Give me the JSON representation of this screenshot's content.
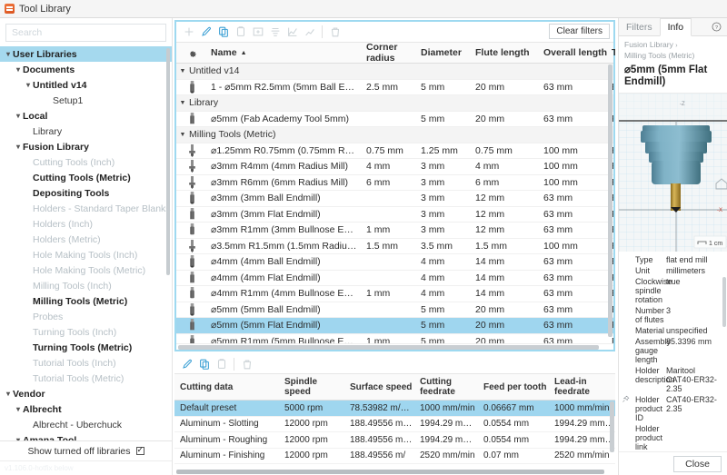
{
  "window": {
    "title": "Tool Library",
    "icon": "fusion-app-icon"
  },
  "search": {
    "placeholder": "Search",
    "value": ""
  },
  "sidebar": {
    "items": [
      {
        "label": "User Libraries",
        "indent": 0,
        "caret": "▾",
        "style": "bold",
        "selected": true
      },
      {
        "label": "Documents",
        "indent": 1,
        "caret": "▾",
        "style": "bold",
        "selected": false
      },
      {
        "label": "Untitled v14",
        "indent": 2,
        "caret": "▾",
        "style": "bold",
        "selected": false
      },
      {
        "label": "Setup1",
        "indent": 4,
        "caret": "",
        "style": "plain",
        "selected": false
      },
      {
        "label": "Local",
        "indent": 1,
        "caret": "▾",
        "style": "bold",
        "selected": false
      },
      {
        "label": "Library",
        "indent": 2,
        "caret": "",
        "style": "plain",
        "selected": false
      },
      {
        "label": "Fusion Library",
        "indent": 1,
        "caret": "▾",
        "style": "bold",
        "selected": false
      },
      {
        "label": "Cutting Tools (Inch)",
        "indent": 2,
        "caret": "",
        "style": "dim",
        "selected": false
      },
      {
        "label": "Cutting Tools (Metric)",
        "indent": 2,
        "caret": "",
        "style": "bold",
        "selected": false
      },
      {
        "label": "Depositing Tools",
        "indent": 2,
        "caret": "",
        "style": "bold",
        "selected": false
      },
      {
        "label": "Holders - Standard Taper Blanks",
        "indent": 2,
        "caret": "",
        "style": "dim",
        "selected": false
      },
      {
        "label": "Holders (Inch)",
        "indent": 2,
        "caret": "",
        "style": "dim",
        "selected": false
      },
      {
        "label": "Holders (Metric)",
        "indent": 2,
        "caret": "",
        "style": "dim",
        "selected": false
      },
      {
        "label": "Hole Making Tools (Inch)",
        "indent": 2,
        "caret": "",
        "style": "dim",
        "selected": false
      },
      {
        "label": "Hole Making Tools (Metric)",
        "indent": 2,
        "caret": "",
        "style": "dim",
        "selected": false
      },
      {
        "label": "Milling Tools (Inch)",
        "indent": 2,
        "caret": "",
        "style": "dim",
        "selected": false
      },
      {
        "label": "Milling Tools (Metric)",
        "indent": 2,
        "caret": "",
        "style": "bold",
        "selected": false
      },
      {
        "label": "Probes",
        "indent": 2,
        "caret": "",
        "style": "dim",
        "selected": false
      },
      {
        "label": "Turning Tools (Inch)",
        "indent": 2,
        "caret": "",
        "style": "dim",
        "selected": false
      },
      {
        "label": "Turning Tools (Metric)",
        "indent": 2,
        "caret": "",
        "style": "bold",
        "selected": false
      },
      {
        "label": "Tutorial Tools (Inch)",
        "indent": 2,
        "caret": "",
        "style": "dim",
        "selected": false
      },
      {
        "label": "Tutorial Tools (Metric)",
        "indent": 2,
        "caret": "",
        "style": "dim",
        "selected": false
      },
      {
        "label": "Vendor",
        "indent": 0,
        "caret": "▾",
        "style": "bold",
        "selected": false
      },
      {
        "label": "Albrecht",
        "indent": 1,
        "caret": "▾",
        "style": "bold",
        "selected": false
      },
      {
        "label": "Albrecht - Uberchuck",
        "indent": 2,
        "caret": "",
        "style": "plain",
        "selected": false
      },
      {
        "label": "Amana Tool",
        "indent": 1,
        "caret": "▾",
        "style": "bold",
        "selected": false
      }
    ],
    "show_turned_off_libraries": "Show turned off libraries",
    "show_turned_off_checked": true,
    "status_text": "v1.106.0-hotfix below"
  },
  "tool_toolbar": {
    "icons": [
      {
        "name": "add-tool-icon",
        "glyph": "plus",
        "enabled": false
      },
      {
        "name": "edit-tool-icon",
        "glyph": "pencil",
        "enabled": true
      },
      {
        "name": "copy-tool-icon",
        "glyph": "copy",
        "enabled": true
      },
      {
        "name": "paste-tool-icon",
        "glyph": "paste",
        "enabled": false
      },
      {
        "name": "new-library-icon",
        "glyph": "newlib",
        "enabled": false
      },
      {
        "name": "holder-icon",
        "glyph": "holder",
        "enabled": false
      },
      {
        "name": "cutting-data-icon",
        "glyph": "cutdata",
        "enabled": false
      },
      {
        "name": "chart-icon",
        "glyph": "chart",
        "enabled": false
      },
      {
        "name": "delete-tool-icon",
        "glyph": "trash",
        "enabled": false
      }
    ],
    "clear_filters_label": "Clear filters"
  },
  "tool_table": {
    "columns": [
      {
        "key": "gear",
        "label": ""
      },
      {
        "key": "name",
        "label": "Name",
        "sort": "▲"
      },
      {
        "key": "corner_radius",
        "label": "Corner radius"
      },
      {
        "key": "diameter",
        "label": "Diameter"
      },
      {
        "key": "flute_length",
        "label": "Flute length"
      },
      {
        "key": "overall_length",
        "label": "Overall length"
      },
      {
        "key": "type",
        "label": "Type"
      }
    ],
    "rows": [
      {
        "kind": "group",
        "label": "Untitled v14",
        "caret": "▾"
      },
      {
        "kind": "tool",
        "icon": "ball-endmill-icon",
        "name": "1 - ⌀5mm R2.5mm (5mm Ball E…",
        "corner_radius": "2.5 mm",
        "diameter": "5 mm",
        "flute_length": "20 mm",
        "overall_length": "63 mm",
        "type": "Ball end mill",
        "selected": false
      },
      {
        "kind": "group",
        "label": "Library",
        "caret": "▾"
      },
      {
        "kind": "tool",
        "icon": "flat-endmill-icon",
        "name": "⌀5mm (Fab Academy Tool 5mm)",
        "corner_radius": "",
        "diameter": "5 mm",
        "flute_length": "20 mm",
        "overall_length": "63 mm",
        "type": "Flat end mill",
        "selected": false
      },
      {
        "kind": "group",
        "label": "Milling Tools (Metric)",
        "caret": "▾"
      },
      {
        "kind": "tool",
        "icon": "radius-mill-icon",
        "name": "⌀1.25mm R0.75mm (0.75mm R…",
        "corner_radius": "0.75 mm",
        "diameter": "1.25 mm",
        "flute_length": "0.75 mm",
        "overall_length": "100 mm",
        "type": "Radius mill",
        "selected": false
      },
      {
        "kind": "tool",
        "icon": "radius-mill-icon",
        "name": "⌀3mm R4mm (4mm Radius Mill)",
        "corner_radius": "4 mm",
        "diameter": "3 mm",
        "flute_length": "4 mm",
        "overall_length": "100 mm",
        "type": "Radius mill",
        "selected": false
      },
      {
        "kind": "tool",
        "icon": "radius-mill-icon",
        "name": "⌀3mm R6mm (6mm Radius Mill)",
        "corner_radius": "6 mm",
        "diameter": "3 mm",
        "flute_length": "6 mm",
        "overall_length": "100 mm",
        "type": "Radius mill",
        "selected": false
      },
      {
        "kind": "tool",
        "icon": "ball-endmill-icon",
        "name": "⌀3mm (3mm Ball Endmill)",
        "corner_radius": "",
        "diameter": "3 mm",
        "flute_length": "12 mm",
        "overall_length": "63 mm",
        "type": "Ball end mill",
        "selected": false
      },
      {
        "kind": "tool",
        "icon": "flat-endmill-icon",
        "name": "⌀3mm (3mm Flat Endmill)",
        "corner_radius": "",
        "diameter": "3 mm",
        "flute_length": "12 mm",
        "overall_length": "63 mm",
        "type": "Flat end mill",
        "selected": false
      },
      {
        "kind": "tool",
        "icon": "bullnose-endmill-icon",
        "name": "⌀3mm R1mm (3mm Bullnose E…",
        "corner_radius": "1 mm",
        "diameter": "3 mm",
        "flute_length": "12 mm",
        "overall_length": "63 mm",
        "type": "Bull nose end…",
        "selected": false
      },
      {
        "kind": "tool",
        "icon": "radius-mill-icon",
        "name": "⌀3.5mm R1.5mm (1.5mm Radiu…",
        "corner_radius": "1.5 mm",
        "diameter": "3.5 mm",
        "flute_length": "1.5 mm",
        "overall_length": "100 mm",
        "type": "Radius mill",
        "selected": false
      },
      {
        "kind": "tool",
        "icon": "ball-endmill-icon",
        "name": "⌀4mm (4mm Ball Endmill)",
        "corner_radius": "",
        "diameter": "4 mm",
        "flute_length": "14 mm",
        "overall_length": "63 mm",
        "type": "Ball end mill",
        "selected": false
      },
      {
        "kind": "tool",
        "icon": "flat-endmill-icon",
        "name": "⌀4mm (4mm Flat Endmill)",
        "corner_radius": "",
        "diameter": "4 mm",
        "flute_length": "14 mm",
        "overall_length": "63 mm",
        "type": "Flat end mill",
        "selected": false
      },
      {
        "kind": "tool",
        "icon": "bullnose-endmill-icon",
        "name": "⌀4mm R1mm (4mm Bullnose E…",
        "corner_radius": "1 mm",
        "diameter": "4 mm",
        "flute_length": "14 mm",
        "overall_length": "63 mm",
        "type": "Bull nose end…",
        "selected": false
      },
      {
        "kind": "tool",
        "icon": "ball-endmill-icon",
        "name": "⌀5mm (5mm Ball Endmill)",
        "corner_radius": "",
        "diameter": "5 mm",
        "flute_length": "20 mm",
        "overall_length": "63 mm",
        "type": "Ball end mill",
        "selected": false
      },
      {
        "kind": "tool",
        "icon": "flat-endmill-icon",
        "name": "⌀5mm (5mm Flat Endmill)",
        "corner_radius": "",
        "diameter": "5 mm",
        "flute_length": "20 mm",
        "overall_length": "63 mm",
        "type": "Flat end mill",
        "selected": true
      },
      {
        "kind": "tool",
        "icon": "bullnose-endmill-icon",
        "name": "⌀5mm R1mm (5mm Bullnose E…",
        "corner_radius": "1 mm",
        "diameter": "5 mm",
        "flute_length": "20 mm",
        "overall_length": "63 mm",
        "type": "Bull nose end…",
        "selected": false
      }
    ]
  },
  "cutting_toolbar": {
    "icons": [
      {
        "name": "edit-preset-icon",
        "glyph": "pencil",
        "enabled": true
      },
      {
        "name": "copy-preset-icon",
        "glyph": "copy",
        "enabled": true
      },
      {
        "name": "paste-preset-icon",
        "glyph": "paste",
        "enabled": false
      },
      {
        "name": "delete-preset-icon",
        "glyph": "trash",
        "enabled": false
      }
    ]
  },
  "cutting_table": {
    "columns": [
      "Cutting data",
      "Spindle speed",
      "Surface speed",
      "Cutting feedrate",
      "Feed per tooth",
      "Lead-in feedrate",
      "Lead-out feedrate",
      "R"
    ],
    "rows": [
      {
        "cells": [
          "Default preset",
          "5000 rpm",
          "78.53982 m/…",
          "1000 mm/min",
          "0.06667 mm",
          "1000 mm/min",
          "1000 mm/min",
          ""
        ],
        "selected": true
      },
      {
        "cells": [
          "Aluminum - Slotting",
          "12000 rpm",
          "188.49556 m/…",
          "1994.29 mm/…",
          "0.0554 mm",
          "1994.29 mm/…",
          "1994.29 mm/…",
          ""
        ],
        "selected": false
      },
      {
        "cells": [
          "Aluminum - Roughing",
          "12000 rpm",
          "188.49556 m/…",
          "1994.29 mm/…",
          "0.0554 mm",
          "1994.29 mm/…",
          "1994.29 mm/…",
          ""
        ],
        "selected": false
      },
      {
        "cells": [
          "Aluminum - Finishing",
          "12000 rpm",
          "188.49556 m/",
          "2520 mm/min",
          "0.07 mm",
          "2520 mm/min",
          "2520 mm/min",
          ""
        ],
        "selected": false
      }
    ]
  },
  "rightpanel": {
    "tabs": [
      {
        "label": "Filters",
        "active": false
      },
      {
        "label": "Info",
        "active": true
      }
    ],
    "help_icon": "help-icon",
    "breadcrumbs": [
      "Fusion Library",
      "Milling Tools (Metric)"
    ],
    "breadcrumb_arrow": "›",
    "title": "⌀5mm (5mm Flat Endmill)",
    "preview": {
      "scale_label": "1 cm",
      "axis_z_label": "-Z",
      "axis_x_label": "-X",
      "home_icon": "home-icon"
    },
    "properties": [
      {
        "label": "Type",
        "value": "flat end mill",
        "pin": false
      },
      {
        "label": "Unit",
        "value": "millimeters",
        "pin": false
      },
      {
        "label": "Clockwise spindle rotation",
        "value": "true",
        "pin": false
      },
      {
        "label": "Number of flutes",
        "value": "3",
        "pin": false
      },
      {
        "label": "Material",
        "value": "unspecified",
        "pin": false
      },
      {
        "label": "Assembly gauge length",
        "value": "85.3396 mm",
        "pin": false
      },
      {
        "label": "Holder description",
        "value": "Maritool CAT40-ER32-2.35",
        "pin": false
      },
      {
        "label": "Holder product ID",
        "value": "CAT40-ER32-2.35",
        "pin": true
      },
      {
        "label": "Holder product link",
        "value": "",
        "pin": false
      }
    ],
    "close_label": "Close"
  },
  "colors": {
    "selection": "#9fd6ef",
    "tree_selection": "#a5d9ee",
    "accent_border": "#9ed9f0",
    "dim_text": "#b7c0c6"
  }
}
